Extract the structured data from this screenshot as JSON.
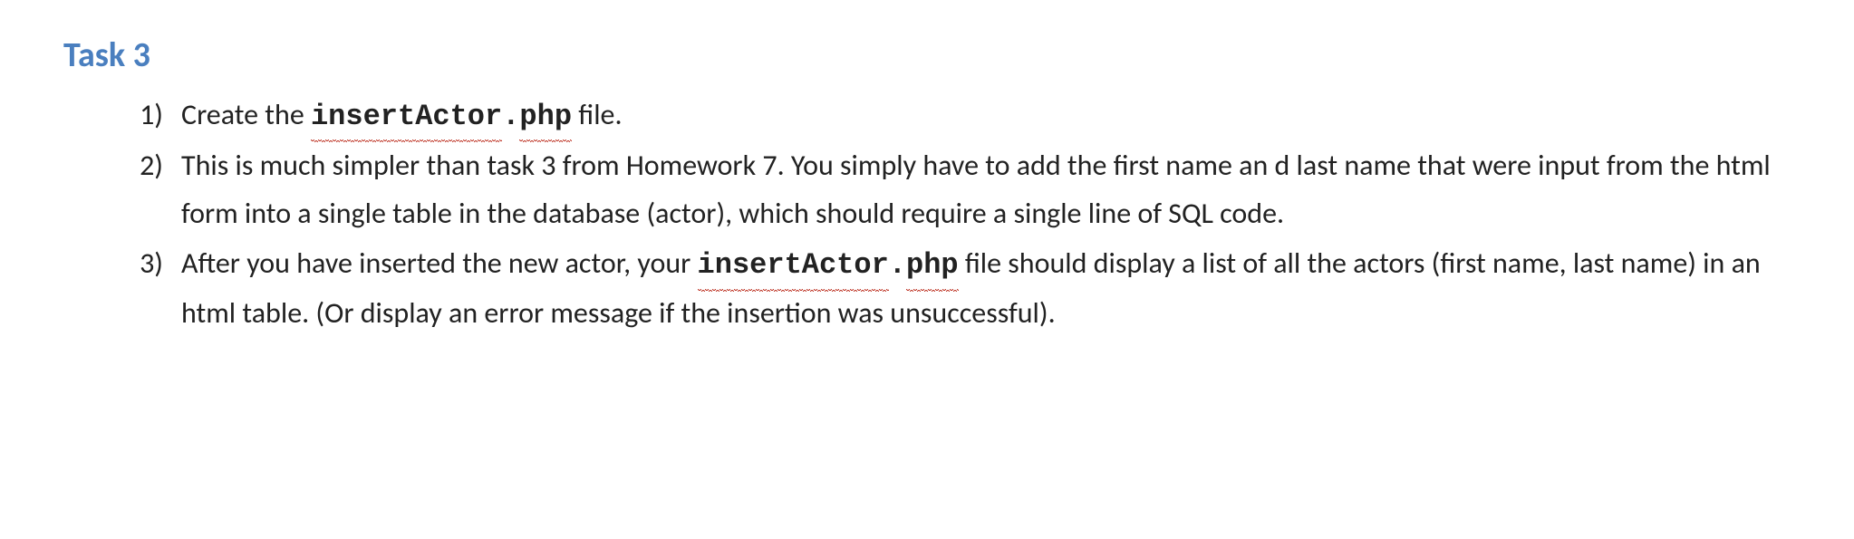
{
  "heading": "Task 3",
  "items": [
    {
      "pre": "Create the ",
      "code1": "insertActor",
      "codeDot": ".",
      "code2": "php",
      "post": " file."
    },
    {
      "plain": "This is much simpler than task 3 from Homework 7.  You simply have to add the first name an d last name that were input from the html form into a single table in the database (actor), which should require a single line of SQL code."
    },
    {
      "pre": "After you have inserted the new actor, your ",
      "code1": "insertActor",
      "codeDot": ".",
      "code2": "php",
      "post": " file should display a list of all the actors (first name, last name) in an html table.  (Or display an error message if the insertion was unsuccessful)."
    }
  ]
}
